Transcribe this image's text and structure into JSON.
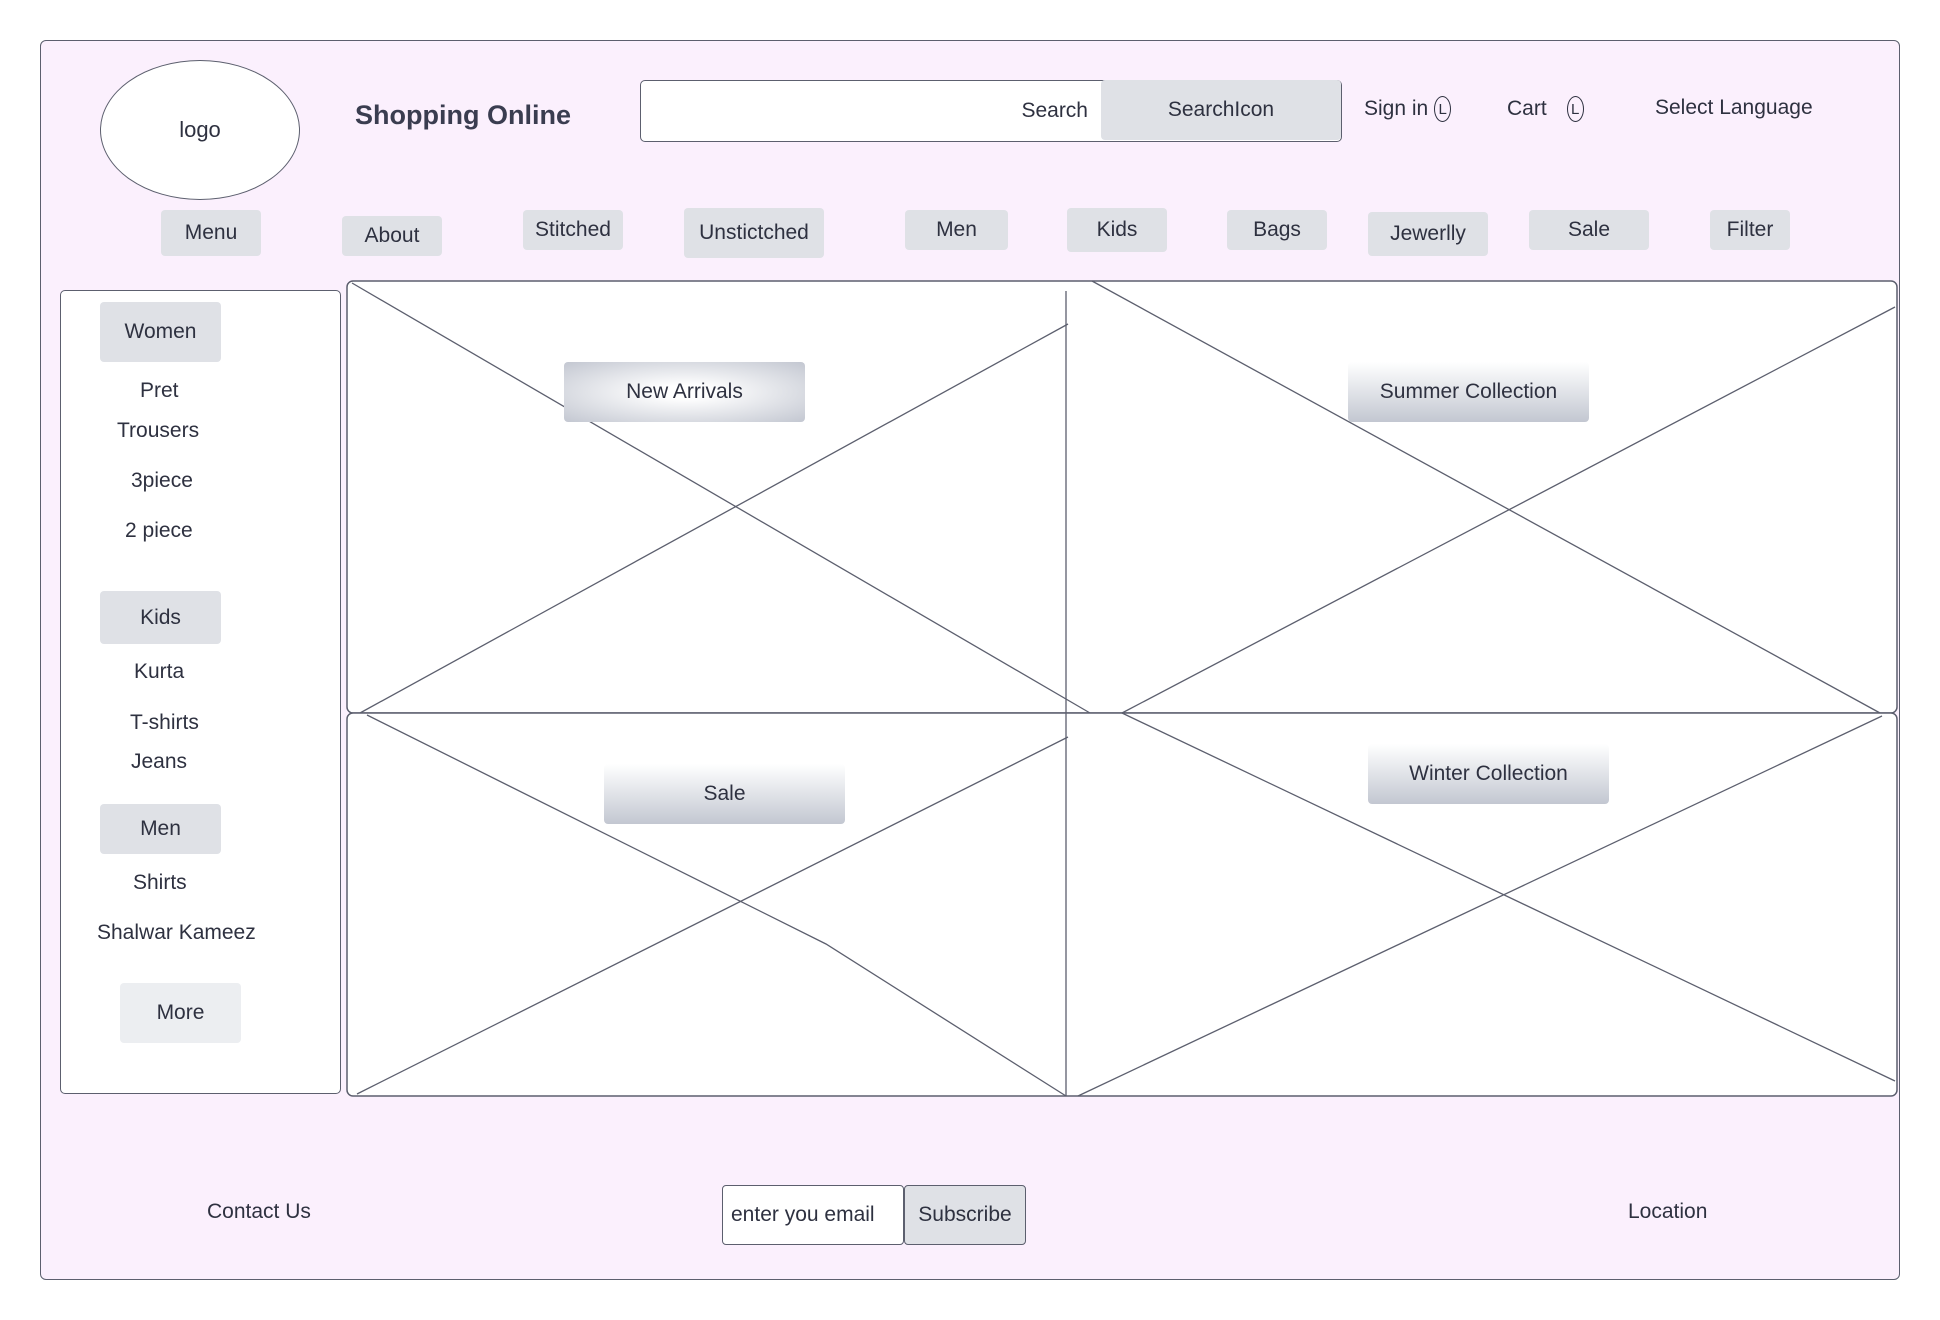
{
  "header": {
    "logo_label": "logo",
    "brand": "Shopping Online",
    "search": {
      "placeholder": "Search",
      "button_label": "SearchIcon"
    },
    "sign_in": {
      "label": "Sign in",
      "icon_glyph": "L"
    },
    "cart": {
      "label": "Cart",
      "icon_glyph": "L"
    },
    "language_label": "Select Language"
  },
  "nav": {
    "items": [
      "Menu",
      "About",
      "Stitched",
      "Unstictched",
      "Men",
      "Kids",
      "Bags",
      "Jewerlly",
      "Sale",
      "Filter"
    ]
  },
  "sidebar": {
    "women": {
      "title": "Women",
      "items": [
        "Pret",
        "Trousers",
        "3piece",
        "2 piece"
      ]
    },
    "kids": {
      "title": "Kids",
      "items": [
        "Kurta",
        "T-shirts",
        "Jeans"
      ]
    },
    "men": {
      "title": "Men",
      "items": [
        "Shirts",
        "Shalwar Kameez"
      ]
    },
    "more_label": "More"
  },
  "promos": {
    "new_arrivals": "New Arrivals",
    "summer": "Summer Collection",
    "sale": "Sale",
    "winter": "Winter Collection"
  },
  "footer": {
    "contact": "Contact Us",
    "email_placeholder": "enter you email",
    "subscribe_label": "Subscribe",
    "location": "Location"
  },
  "colors": {
    "page_background": "#fbf0fd",
    "button_grey": "#dfe1e6",
    "outline": "#5c5f6e"
  }
}
